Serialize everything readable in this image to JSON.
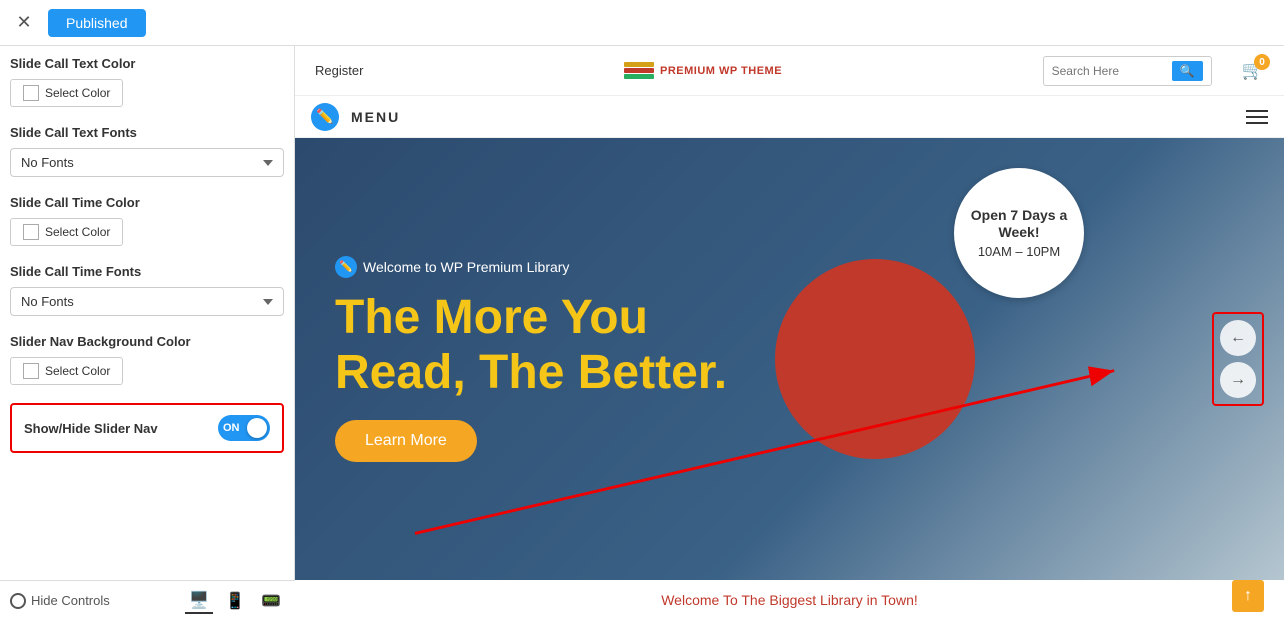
{
  "topbar": {
    "close_label": "✕",
    "published_label": "Published"
  },
  "left_panel": {
    "sections": [
      {
        "id": "slide-call-text-color",
        "title": "Slide Call Text Color",
        "type": "color",
        "button_label": "Select Color"
      },
      {
        "id": "slide-call-text-fonts",
        "title": "Slide Call Text Fonts",
        "type": "font",
        "selected": "No Fonts"
      },
      {
        "id": "slide-call-time-color",
        "title": "Slide Call Time Color",
        "type": "color",
        "button_label": "Select Color"
      },
      {
        "id": "slide-call-time-fonts",
        "title": "Slide Call Time Fonts",
        "type": "font",
        "selected": "No Fonts"
      },
      {
        "id": "slider-nav-bg-color",
        "title": "Slider Nav Background Color",
        "type": "color",
        "button_label": "Select Color"
      }
    ],
    "toggle": {
      "label": "Show/Hide Slider Nav",
      "state": "ON"
    }
  },
  "bottom_bar": {
    "hide_controls_label": "Hide Controls",
    "device_icons": [
      "desktop",
      "tablet",
      "mobile"
    ]
  },
  "site_header": {
    "register": "Register",
    "logo_text": "PREMIUM WP THEME",
    "search_placeholder": "Search Here",
    "cart_count": "0"
  },
  "site_nav": {
    "menu_label": "MENU"
  },
  "hero": {
    "small_text": "Welcome to WP Premium Library",
    "title_line1": "The More You",
    "title_line2": "Read, The",
    "title_highlight": "Better.",
    "button_label": "Learn More",
    "open_hours_title": "Open 7 Days a Week!",
    "open_hours_time": "10AM – 10PM"
  },
  "nav_arrows": {
    "left_arrow": "←",
    "right_arrow": "→"
  },
  "preview_bottom": {
    "text": "Welcome To The Biggest Library in Town!"
  },
  "yellow_btn": {
    "label": "↑"
  }
}
